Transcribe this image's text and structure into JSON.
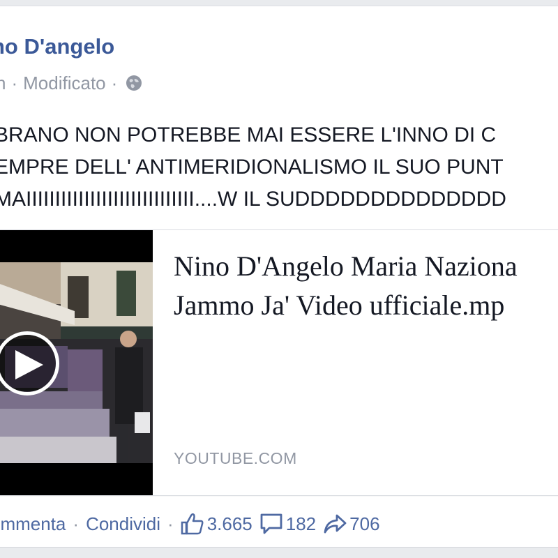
{
  "post": {
    "author": "no D'angelo",
    "meta": {
      "time": "n",
      "edited": "Modificato",
      "privacy_icon": "globe-icon"
    },
    "text_lines": [
      "BRANO NON POTREBBE MAI ESSERE L'INNO DI C",
      "EMPRE DELL' ANTIMERIDIONALISMO IL SUO PUNT",
      "MAIIIIIIIIIIIIIIIIIIIIIIIIIIIII....W IL SUDDDDDDDDDDDDDD"
    ]
  },
  "link_preview": {
    "title_lines": [
      "Nino D'Angelo Maria Naziona",
      "Jammo Ja' Video ufficiale.mp"
    ],
    "domain": "YOUTUBE.COM",
    "thumbnail_icon": "play-icon"
  },
  "actions": {
    "comment": "ommenta",
    "share": "Condividi",
    "separator": "·",
    "likes": "3.665",
    "comments": "182",
    "shares": "706",
    "like_icon": "thumbs-up-icon",
    "comment_icon": "comment-bubble-icon",
    "share_icon": "share-arrow-icon"
  },
  "colors": {
    "link_blue": "#3b5998",
    "meta_gray": "#9197a3",
    "text": "#141823",
    "page_bg": "#e9ebee"
  }
}
